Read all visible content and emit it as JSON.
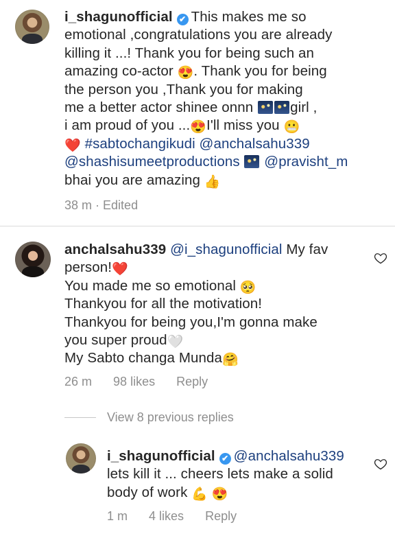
{
  "comment1": {
    "username": "i_shagunofficial",
    "verified_glyph": "✔",
    "text_a": "This makes me so\nemotional ,congratulations you are already\nkilling it ...! Thank you for being such an\namazing co-actor ",
    "emoji_a": "😍",
    "text_b": ". Thank you for being\nthe person you ,Thank you for making\nme a better actor shinee onnn ",
    "text_c": "girl ,\ni am proud of you ...",
    "emoji_b": "😍",
    "text_d": "I'll miss you ",
    "emoji_c": "😬",
    "emoji_heart": "❤️",
    "hashtag": "#sabtochangikudi",
    "mention1": "@anchalsahu339",
    "mention2": "@shashisumeetproductions",
    "mention3": "@pravisht_m",
    "text_e": "bhai you are amazing ",
    "emoji_thumb": "👍",
    "time": "38 m",
    "edited": "· Edited"
  },
  "comment2": {
    "username": "anchalsahu339",
    "mention": "@i_shagunofficial",
    "text_a": " My fav\nperson!",
    "emoji_heart": "❤️",
    "text_b": "\nYou made me so emotional ",
    "emoji_pleading": "🥺",
    "text_c": "\nThankyou for all the motivation!\nThankyou for being you,I'm gonna make\nyou super proud",
    "emoji_white_heart": "🤍",
    "text_d": "\nMy Sabto changa Munda",
    "emoji_hug": "🤗",
    "time": "26 m",
    "likes": "98 likes",
    "reply": "Reply"
  },
  "view_replies": "View 8 previous replies",
  "reply1": {
    "username": "i_shagunofficial",
    "mention": "@anchalsahu339",
    "text": "\nlets kill it ... cheers lets make a solid\nbody of work ",
    "emoji_muscle": "💪",
    "emoji_love": "😍",
    "time": "1 m",
    "likes": "4 likes",
    "reply": "Reply"
  },
  "colors": {
    "link": "#1c3f7e",
    "meta": "#8e8e8e",
    "verified": "#3897f0"
  }
}
